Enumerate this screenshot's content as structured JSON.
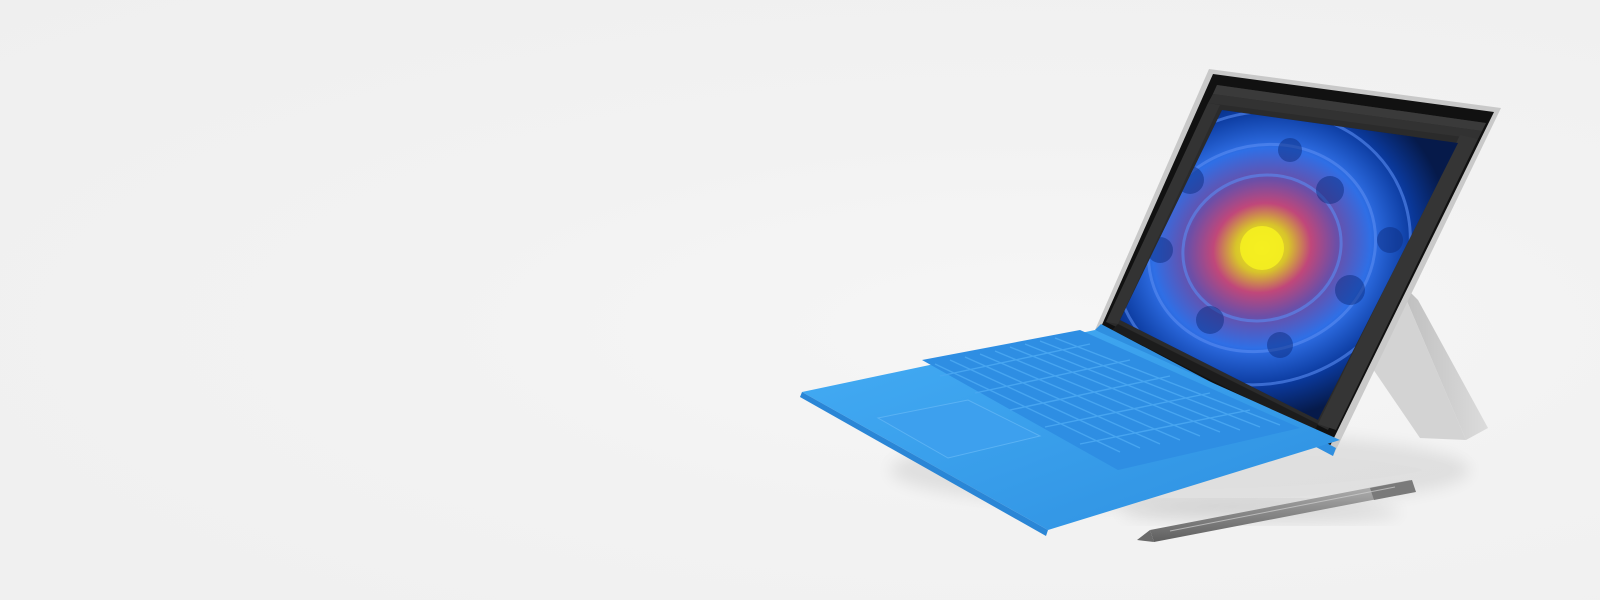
{
  "scene": {
    "background_color": "#f2f2f2",
    "product_image": {
      "subject": "tablet-with-keyboard-cover-and-pen",
      "keyboard_color": "#3aa3f0",
      "bezel_color": "#111111",
      "chassis_color": "#c9c9c9",
      "screen_app_colors": {
        "app_chrome": "#2b2b2b",
        "panel": "#3a3a3a",
        "flower_outer": "#0b3a9e",
        "flower_mid": "#2f6fe6",
        "flower_center": "#e8e020",
        "flower_core": "#c0477a"
      },
      "pen_color": "#9a9a9a"
    }
  }
}
